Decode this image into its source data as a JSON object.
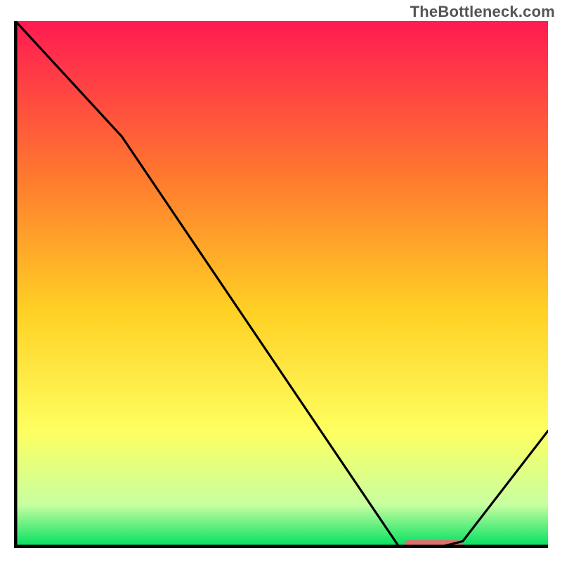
{
  "watermark": "TheBottleneck.com",
  "colors": {
    "gradient_top": "#ff1a52",
    "gradient_upper_mid": "#ff7a2e",
    "gradient_mid": "#ffd024",
    "gradient_lower_mid": "#feff60",
    "gradient_low": "#c8ffa0",
    "gradient_bottom": "#00e060",
    "axis": "#000000",
    "curve": "#000000",
    "marker": "#d9716f"
  },
  "chart_data": {
    "type": "line",
    "title": "",
    "xlabel": "",
    "ylabel": "",
    "xlim": [
      0,
      100
    ],
    "ylim": [
      0,
      100
    ],
    "grid": false,
    "legend": false,
    "x": [
      0,
      20,
      72,
      80,
      84,
      100
    ],
    "values": [
      100,
      78,
      0,
      0,
      1,
      22
    ],
    "optimum_marker": {
      "x_start": 73,
      "x_end": 84,
      "y": 0
    },
    "annotations": []
  }
}
